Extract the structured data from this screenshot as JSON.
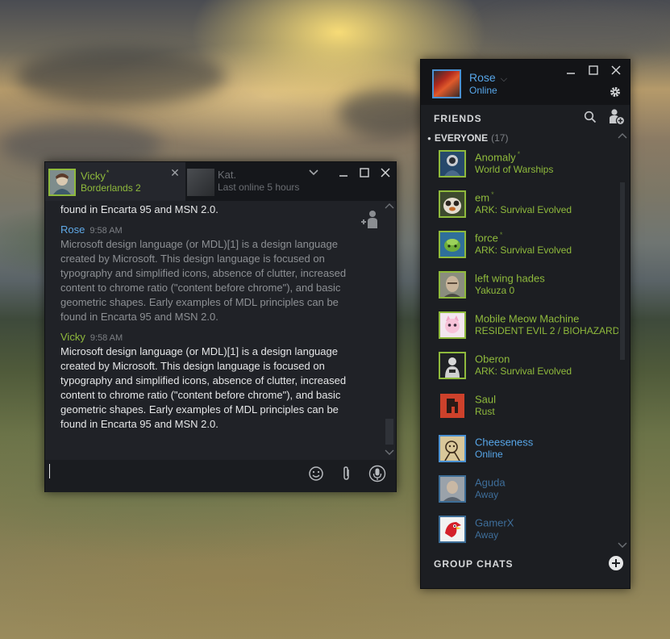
{
  "chat_window": {
    "active_tab": {
      "name": "Vicky",
      "star": "*",
      "game": "Borderlands 2"
    },
    "inactive_tab": {
      "name": "Kat.",
      "status": "Last online 5 hours"
    },
    "messages": {
      "cut_off_text": "found in Encarta 95 and MSN 2.0.",
      "first": {
        "author": "Rose",
        "time": "9:58 AM",
        "text": "Microsoft design language (or MDL)[1] is a design language created by Microsoft. This design language is focused on typography and simplified icons, absence of clutter, increased content to chrome ratio (\"content before chrome\"), and basic geometric shapes. Early examples of MDL principles can be found in Encarta 95 and MSN 2.0."
      },
      "second": {
        "author": "Vicky",
        "time": "9:58 AM",
        "text": "Microsoft design language (or MDL)[1] is a design language created by Microsoft. This design language is focused on typography and simplified icons, absence of clutter, increased content to chrome ratio (\"content before chrome\"), and basic geometric shapes. Early examples of MDL principles can be found in Encarta 95 and MSN 2.0."
      }
    },
    "icons": [
      "close-icon",
      "chevron-down-icon",
      "minimize-icon",
      "maximize-icon",
      "add-person-icon",
      "emoji-icon",
      "attachment-icon",
      "microphone-icon"
    ]
  },
  "friends_window": {
    "user": {
      "name": "Rose",
      "status": "Online"
    },
    "friends_label": "FRIENDS",
    "everyone_label": "EVERYONE",
    "everyone_count": "(17)",
    "group_chats_label": "GROUP CHATS",
    "friends": [
      {
        "name": "Anomaly",
        "star": "*",
        "status": "World of Warships",
        "state": "in-game"
      },
      {
        "name": "em",
        "star": "*",
        "status": "ARK: Survival Evolved",
        "state": "in-game"
      },
      {
        "name": "force",
        "star": "*",
        "status": "ARK: Survival Evolved",
        "state": "in-game"
      },
      {
        "name": "left wing hades",
        "star": "",
        "status": "Yakuza 0",
        "state": "in-game"
      },
      {
        "name": "Mobile Meow Machine",
        "star": "",
        "status": "RESIDENT EVIL 2 / BIOHAZARD",
        "state": "in-game"
      },
      {
        "name": "Oberon",
        "star": "",
        "status": "ARK: Survival Evolved",
        "state": "in-game"
      },
      {
        "name": "Saul",
        "star": "",
        "status": "Rust",
        "state": "in-game"
      },
      {
        "name": "Cheeseness",
        "star": "",
        "status": "Online",
        "state": "online"
      },
      {
        "name": "Aguda",
        "star": "",
        "status": "Away",
        "state": "away"
      },
      {
        "name": "GamerX",
        "star": "",
        "status": "Away",
        "state": "away"
      }
    ],
    "colors": {
      "in_game": "#8fba3c",
      "online": "#57a6e8",
      "away": "#3e6e9a"
    }
  }
}
